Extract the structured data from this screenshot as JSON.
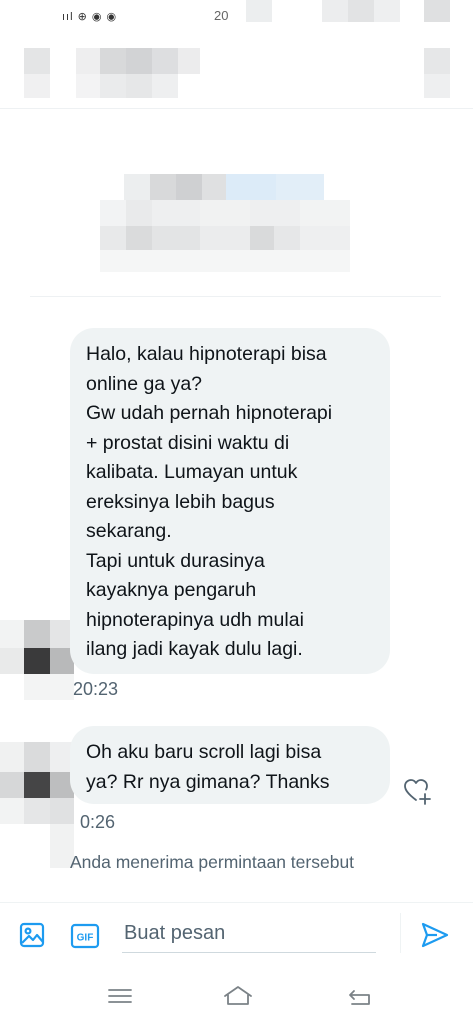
{
  "status_bar": {
    "signal_icons": "ııl ⊕ ◉ ◉",
    "time": "20"
  },
  "conversation": {
    "messages": [
      {
        "lines": [
          "Halo, kalau hipnoterapi bisa",
          "online ga ya?",
          "Gw udah pernah hipnoterapi",
          "+ prostat disini waktu di",
          "kalibata. Lumayan untuk",
          "ereksinya lebih bagus",
          "sekarang.",
          "Tapi untuk durasinya",
          "kayaknya pengaruh",
          "hipnoterapinya udh mulai",
          "ilang jadi kayak dulu lagi."
        ],
        "time": "20:23"
      },
      {
        "lines": [
          "Oh aku baru scroll lagi bisa",
          "ya? Rr nya gimana? Thanks"
        ],
        "time": "0:26"
      }
    ],
    "accept_note": "Anda menerima permintaan tersebut"
  },
  "composer": {
    "placeholder": "Buat pesan",
    "gif_label": "GIF"
  },
  "icons": {
    "image": "image-icon",
    "gif": "gif-icon",
    "send": "send-icon",
    "react": "heart-plus-icon",
    "nav_menu": "menu-icon",
    "nav_home": "home-icon",
    "nav_back": "back-icon"
  },
  "colors": {
    "accent": "#1d9bf0",
    "bubble": "#eff3f4",
    "muted_text": "#536471"
  }
}
